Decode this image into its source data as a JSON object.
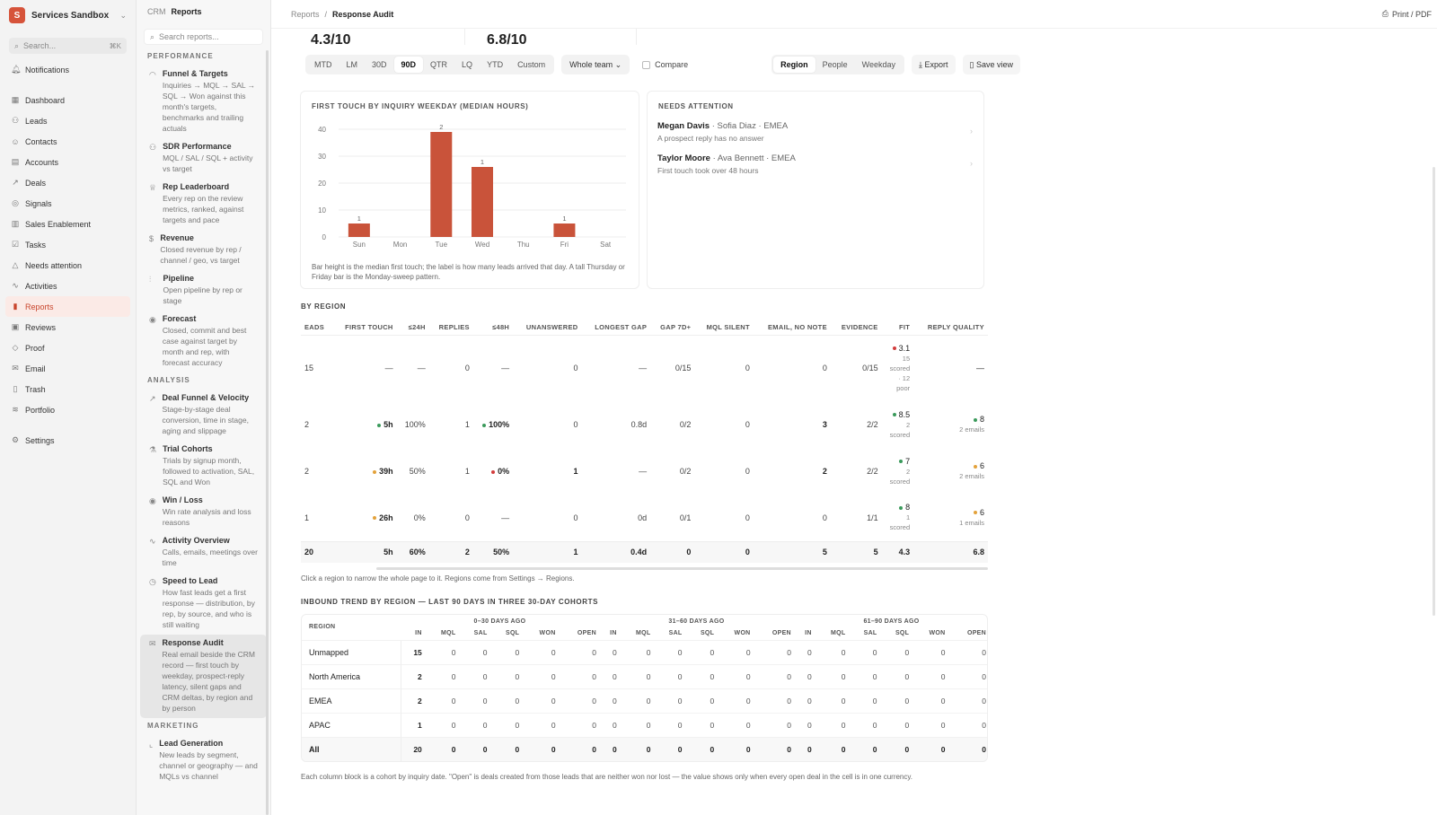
{
  "sidebar": {
    "workspace": "Services Sandbox",
    "workspace_initial": "S",
    "search_placeholder": "Search...",
    "search_kbd": "⌘K",
    "items": [
      {
        "label": "Notifications",
        "icon": "bell-icon",
        "glyph": "🔔︎"
      },
      {
        "label": "Dashboard",
        "icon": "grid-icon",
        "glyph": "▦"
      },
      {
        "label": "Leads",
        "icon": "users-icon",
        "glyph": "⚇"
      },
      {
        "label": "Contacts",
        "icon": "user-icon",
        "glyph": "☺"
      },
      {
        "label": "Accounts",
        "icon": "building-icon",
        "glyph": "▤"
      },
      {
        "label": "Deals",
        "icon": "trend-icon",
        "glyph": "↗"
      },
      {
        "label": "Signals",
        "icon": "signal-icon",
        "glyph": "◎"
      },
      {
        "label": "Sales Enablement",
        "icon": "book-icon",
        "glyph": "▥"
      },
      {
        "label": "Tasks",
        "icon": "check-icon",
        "glyph": "☑"
      },
      {
        "label": "Needs attention",
        "icon": "alert-icon",
        "glyph": "△"
      },
      {
        "label": "Activities",
        "icon": "activity-icon",
        "glyph": "∿"
      },
      {
        "label": "Reports",
        "icon": "chart-icon",
        "glyph": "▮"
      },
      {
        "label": "Reviews",
        "icon": "review-icon",
        "glyph": "▣"
      },
      {
        "label": "Proof",
        "icon": "proof-icon",
        "glyph": "◇"
      },
      {
        "label": "Email",
        "icon": "mail-icon",
        "glyph": "✉"
      },
      {
        "label": "Trash",
        "icon": "trash-icon",
        "glyph": "▯"
      },
      {
        "label": "Portfolio",
        "icon": "layers-icon",
        "glyph": "≋"
      },
      {
        "label": "Settings",
        "icon": "gear-icon",
        "glyph": "⚙"
      }
    ]
  },
  "reports_panel": {
    "breadcrumb_root": "CRM",
    "breadcrumb_current": "Reports",
    "search_placeholder": "Search reports...",
    "sections": [
      {
        "title": "PERFORMANCE",
        "items": [
          {
            "title": "Funnel & Targets",
            "desc": "Inquiries → MQL → SAL → SQL → Won against this month's targets, benchmarks and trailing actuals",
            "glyph": "◠"
          },
          {
            "title": "SDR Performance",
            "desc": "MQL / SAL / SQL + activity vs target",
            "glyph": "⚇"
          },
          {
            "title": "Rep Leaderboard",
            "desc": "Every rep on the review metrics, ranked, against targets and pace",
            "glyph": "♕"
          },
          {
            "title": "Revenue",
            "desc": "Closed revenue by rep / channel / geo, vs target",
            "glyph": "$"
          },
          {
            "title": "Pipeline",
            "desc": "Open pipeline by rep or stage",
            "glyph": "⫶"
          },
          {
            "title": "Forecast",
            "desc": "Closed, commit and best case against target by month and rep, with forecast accuracy",
            "glyph": "◉"
          }
        ]
      },
      {
        "title": "ANALYSIS",
        "items": [
          {
            "title": "Deal Funnel & Velocity",
            "desc": "Stage-by-stage deal conversion, time in stage, aging and slippage",
            "glyph": "↗"
          },
          {
            "title": "Trial Cohorts",
            "desc": "Trials by signup month, followed to activation, SAL, SQL and Won",
            "glyph": "⚗"
          },
          {
            "title": "Win / Loss",
            "desc": "Win rate analysis and loss reasons",
            "glyph": "◉"
          },
          {
            "title": "Activity Overview",
            "desc": "Calls, emails, meetings over time",
            "glyph": "∿"
          },
          {
            "title": "Speed to Lead",
            "desc": "How fast leads get a first response — distribution, by rep, by source, and who is still waiting",
            "glyph": "◷"
          },
          {
            "title": "Response Audit",
            "desc": "Real email beside the CRM record — first touch by weekday, prospect-reply latency, silent gaps and CRM deltas, by region and by person",
            "glyph": "✉"
          }
        ]
      },
      {
        "title": "MARKETING",
        "items": [
          {
            "title": "Lead Generation",
            "desc": "New leads by segment, channel or geography — and MQLs vs channel",
            "glyph": "⌞"
          }
        ]
      }
    ]
  },
  "topbar": {
    "root": "Reports",
    "current": "Response Audit",
    "print_label": "Print / PDF"
  },
  "scores": [
    "4.3/10",
    "6.8/10"
  ],
  "controls": {
    "periods": [
      "MTD",
      "LM",
      "30D",
      "90D",
      "QTR",
      "LQ",
      "YTD",
      "Custom"
    ],
    "active_period": "90D",
    "team": "Whole team ⌄",
    "compare": "Compare",
    "groupings": [
      "Region",
      "People",
      "Weekday"
    ],
    "active_grouping": "Region",
    "export": "Export",
    "save": "Save view"
  },
  "chart_data": {
    "type": "bar",
    "title": "FIRST TOUCH BY INQUIRY WEEKDAY (MEDIAN HOURS)",
    "categories": [
      "Sun",
      "Mon",
      "Tue",
      "Wed",
      "Thu",
      "Fri",
      "Sat"
    ],
    "values": [
      5,
      0,
      39,
      26,
      0,
      5,
      0
    ],
    "counts": [
      "1",
      "",
      "2",
      "1",
      "",
      "1",
      ""
    ],
    "yticks": [
      0,
      10,
      20,
      30,
      40
    ],
    "ylim": [
      0,
      40
    ],
    "color": "#c9533a",
    "note": "Bar height is the median first touch; the label is how many leads arrived that day. A tall Thursday or Friday bar is the Monday-sweep pattern."
  },
  "needs_attention": {
    "title": "NEEDS ATTENTION",
    "items": [
      {
        "name": "Megan Davis",
        "meta": "· Sofia Diaz · EMEA",
        "desc": "A prospect reply has no answer"
      },
      {
        "name": "Taylor Moore",
        "meta": "· Ava Bennett · EMEA",
        "desc": "First touch took over 48 hours"
      }
    ]
  },
  "by_region": {
    "title": "BY REGION",
    "headers": [
      "EADS",
      "FIRST TOUCH",
      "≤24H",
      "REPLIES",
      "≤48H",
      "UNANSWERED",
      "LONGEST GAP",
      "GAP 7D+",
      "MQL SILENT",
      "EMAIL, NO NOTE",
      "EVIDENCE",
      "FIT",
      "REPLY QUALITY"
    ],
    "rows": [
      {
        "leads": "15",
        "first_touch": "—",
        "ft_dot": "",
        "le24": "—",
        "replies": "0",
        "le48": "—",
        "le48_dot": "",
        "unanswered": "0",
        "longest_gap": "—",
        "gap7": "0/15",
        "mql_silent": "0",
        "email_no_note": "0",
        "evidence": "0/15",
        "fit": "3.1",
        "fit_dot": "#d23d3d",
        "fit_sub": [
          "15",
          "scored",
          "· 12",
          "poor"
        ],
        "rq": "—",
        "rq_dot": "",
        "rq_sub": ""
      },
      {
        "leads": "2",
        "first_touch": "5h",
        "ft_dot": "#3a9a5b",
        "le24": "100%",
        "replies": "1",
        "le48": "100%",
        "le48_dot": "#3a9a5b",
        "unanswered": "0",
        "longest_gap": "0.8d",
        "gap7": "0/2",
        "mql_silent": "0",
        "email_no_note": "3",
        "evidence": "2/2",
        "fit": "8.5",
        "fit_dot": "#3a9a5b",
        "fit_sub": [
          "2",
          "scored"
        ],
        "rq": "8",
        "rq_dot": "#3a9a5b",
        "rq_sub": "2 emails"
      },
      {
        "leads": "2",
        "first_touch": "39h",
        "ft_dot": "#e3a23b",
        "le24": "50%",
        "replies": "1",
        "le48": "0%",
        "le48_dot": "#d23d3d",
        "unanswered": "1",
        "longest_gap": "—",
        "gap7": "0/2",
        "mql_silent": "0",
        "email_no_note": "2",
        "evidence": "2/2",
        "fit": "7",
        "fit_dot": "#3a9a5b",
        "fit_sub": [
          "2",
          "scored"
        ],
        "rq": "6",
        "rq_dot": "#e3a23b",
        "rq_sub": "2 emails"
      },
      {
        "leads": "1",
        "first_touch": "26h",
        "ft_dot": "#e3a23b",
        "le24": "0%",
        "replies": "0",
        "le48": "—",
        "le48_dot": "",
        "unanswered": "0",
        "longest_gap": "0d",
        "gap7": "0/1",
        "mql_silent": "0",
        "email_no_note": "0",
        "evidence": "1/1",
        "fit": "8",
        "fit_dot": "#3a9a5b",
        "fit_sub": [
          "1",
          "scored"
        ],
        "rq": "6",
        "rq_dot": "#e3a23b",
        "rq_sub": "1 emails"
      }
    ],
    "total": [
      "20",
      "5h",
      "60%",
      "2",
      "50%",
      "1",
      "0.4d",
      "0",
      "0",
      "5",
      "5",
      "4.3",
      "6.8"
    ],
    "footnote": "Click a region to narrow the whole page to it. Regions come from Settings → Regions."
  },
  "trend": {
    "title": "INBOUND TREND BY REGION — LAST 90 DAYS IN THREE 30-DAY COHORTS",
    "region_header": "REGION",
    "cohorts": [
      "0–30 DAYS AGO",
      "31–60 DAYS AGO",
      "61–90 DAYS AGO"
    ],
    "cols": [
      "IN",
      "MQL",
      "SAL",
      "SQL",
      "WON",
      "OPEN"
    ],
    "rows": [
      {
        "name": "Unmapped",
        "vals": [
          "15",
          "0",
          "0",
          "0",
          "0",
          "0",
          "0",
          "0",
          "0",
          "0",
          "0",
          "0",
          "0",
          "0",
          "0",
          "0",
          "0",
          "0"
        ]
      },
      {
        "name": "North America",
        "vals": [
          "2",
          "0",
          "0",
          "0",
          "0",
          "0",
          "0",
          "0",
          "0",
          "0",
          "0",
          "0",
          "0",
          "0",
          "0",
          "0",
          "0",
          "0"
        ]
      },
      {
        "name": "EMEA",
        "vals": [
          "2",
          "0",
          "0",
          "0",
          "0",
          "0",
          "0",
          "0",
          "0",
          "0",
          "0",
          "0",
          "0",
          "0",
          "0",
          "0",
          "0",
          "0"
        ]
      },
      {
        "name": "APAC",
        "vals": [
          "1",
          "0",
          "0",
          "0",
          "0",
          "0",
          "0",
          "0",
          "0",
          "0",
          "0",
          "0",
          "0",
          "0",
          "0",
          "0",
          "0",
          "0"
        ]
      },
      {
        "name": "All",
        "vals": [
          "20",
          "0",
          "0",
          "0",
          "0",
          "0",
          "0",
          "0",
          "0",
          "0",
          "0",
          "0",
          "0",
          "0",
          "0",
          "0",
          "0",
          "0"
        ]
      }
    ],
    "footnote": "Each column block is a cohort by inquiry date. \"Open\" is deals created from those leads that are neither won nor lost — the value shows only when every open deal in the cell is in one currency."
  }
}
